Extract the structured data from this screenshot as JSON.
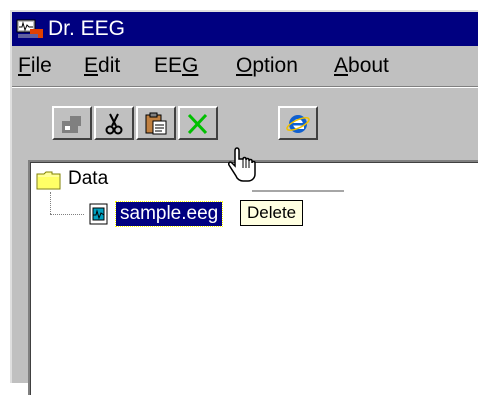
{
  "window": {
    "title": "Dr. EEG",
    "app_icon": "eeg-app-icon"
  },
  "menu": {
    "items": [
      {
        "label_ul": "F",
        "label_rest": "ile"
      },
      {
        "label_ul": "E",
        "label_rest": "dit"
      },
      {
        "label_pre": "EE",
        "label_ul": "G"
      },
      {
        "label_ul": "O",
        "label_rest": "ption"
      },
      {
        "label_ul": "A",
        "label_rest": "bout"
      }
    ]
  },
  "toolbar": {
    "buttons": [
      {
        "icon": "cut-alt-icon",
        "enabled": false
      },
      {
        "icon": "scissors-icon",
        "enabled": true
      },
      {
        "icon": "paste-icon",
        "enabled": true
      },
      {
        "icon": "delete-x-icon",
        "enabled": true
      },
      {
        "icon": "internet-explorer-icon",
        "enabled": true
      }
    ]
  },
  "tree": {
    "root_label": "Data",
    "root_icon": "folder-icon",
    "children": [
      {
        "label": "sample.eeg",
        "icon": "eeg-file-icon",
        "selected": true
      }
    ]
  },
  "tooltip": {
    "text": "Delete"
  },
  "colors": {
    "titlebar": "#000080",
    "window_face": "#c0c0c0",
    "selection": "#000080",
    "tooltip_bg": "#ffffe1",
    "delete_icon": "#00c000"
  }
}
